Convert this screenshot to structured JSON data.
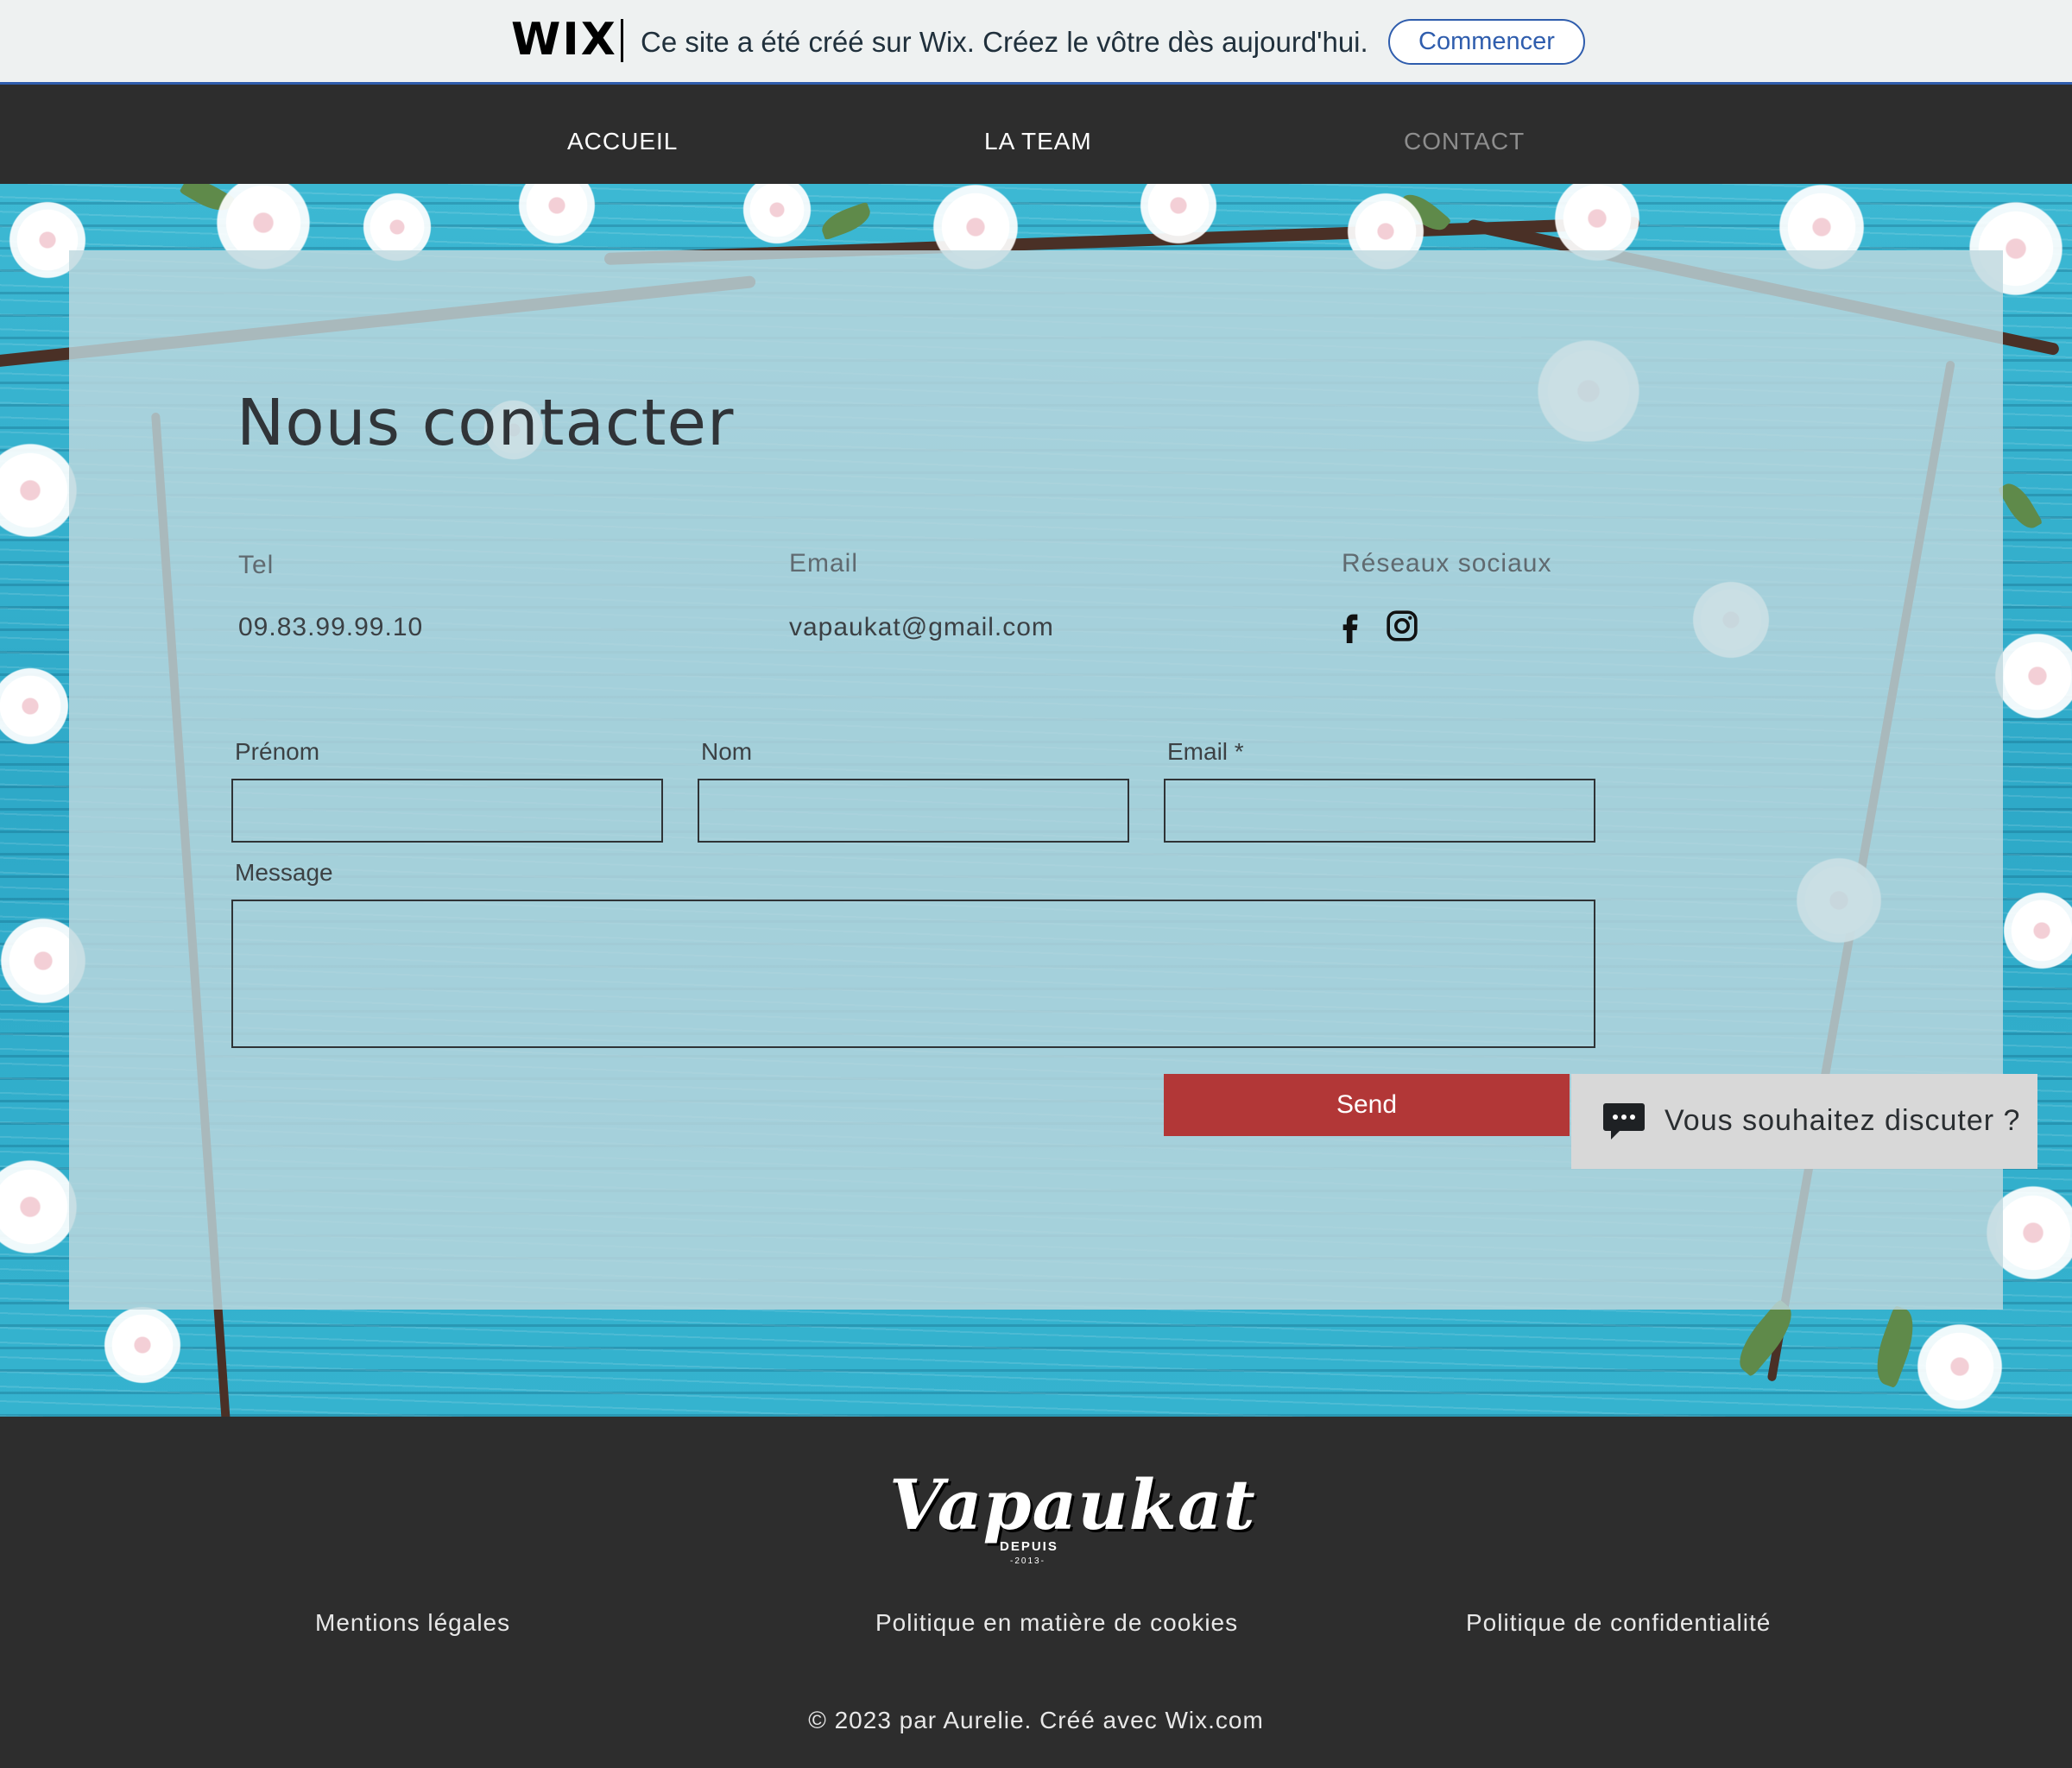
{
  "wix_banner": {
    "logo": "WIX",
    "message": "Ce site a été créé sur Wix. Créez le vôtre dès aujourd'hui.",
    "cta_label": "Commencer"
  },
  "nav": {
    "items": [
      {
        "label": "ACCUEIL"
      },
      {
        "label": "LA TEAM"
      },
      {
        "label": "CONTACT",
        "active": true
      }
    ]
  },
  "contact": {
    "title": "Nous contacter",
    "tel_label": "Tel",
    "tel_value": "09.83.99.99.10",
    "email_label": "Email",
    "email_value": "vapaukat@gmail.com",
    "social_label": "Réseaux sociaux",
    "social_icons": [
      "facebook-icon",
      "instagram-icon"
    ]
  },
  "form": {
    "first_name_label": "Prénom",
    "first_name_value": "",
    "last_name_label": "Nom",
    "last_name_value": "",
    "email_label": "Email *",
    "email_value": "",
    "message_label": "Message",
    "message_value": "",
    "send_label": "Send",
    "send_color": "#b23737"
  },
  "chat": {
    "label": "Vous souhaitez discuter ?",
    "icon": "chat-bubble-icon"
  },
  "footer": {
    "logo_text": "Vapaukat",
    "logo_sub": "DEPUIS",
    "logo_year": "-2013-",
    "links": [
      {
        "label": "Mentions légales"
      },
      {
        "label": "Politique en matière de cookies"
      },
      {
        "label": "Politique de confidentialité"
      }
    ],
    "copyright": "© 2023 par Aurelie. Créé avec Wix.com"
  },
  "colors": {
    "dark_bg": "#2d2d2d",
    "accent_blue": "#2f5dad",
    "wood_blue": "#35b3cf"
  }
}
